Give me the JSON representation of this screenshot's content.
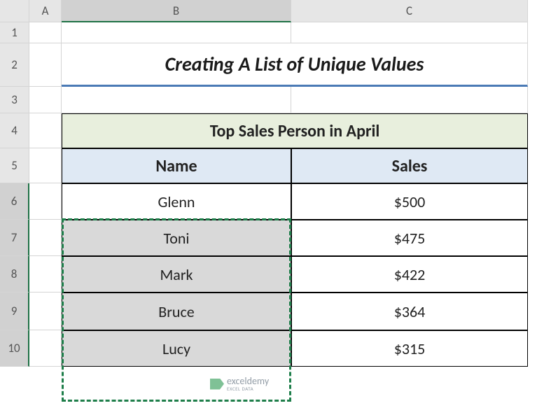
{
  "columns": [
    "A",
    "B",
    "C"
  ],
  "rows": [
    "1",
    "2",
    "3",
    "4",
    "5",
    "6",
    "7",
    "8",
    "9",
    "10"
  ],
  "title": "Creating A List of Unique Values",
  "table": {
    "caption": "Top Sales Person in April",
    "headers": {
      "name": "Name",
      "sales": "Sales"
    },
    "rows": [
      {
        "name": "Glenn",
        "sales": "$500"
      },
      {
        "name": "Toni",
        "sales": "$475"
      },
      {
        "name": "Mark",
        "sales": "$422"
      },
      {
        "name": "Bruce",
        "sales": "$364"
      },
      {
        "name": "Lucy",
        "sales": "$315"
      }
    ]
  },
  "watermark": {
    "brand": "exceldemy",
    "tag": "EXCEL DATA"
  }
}
